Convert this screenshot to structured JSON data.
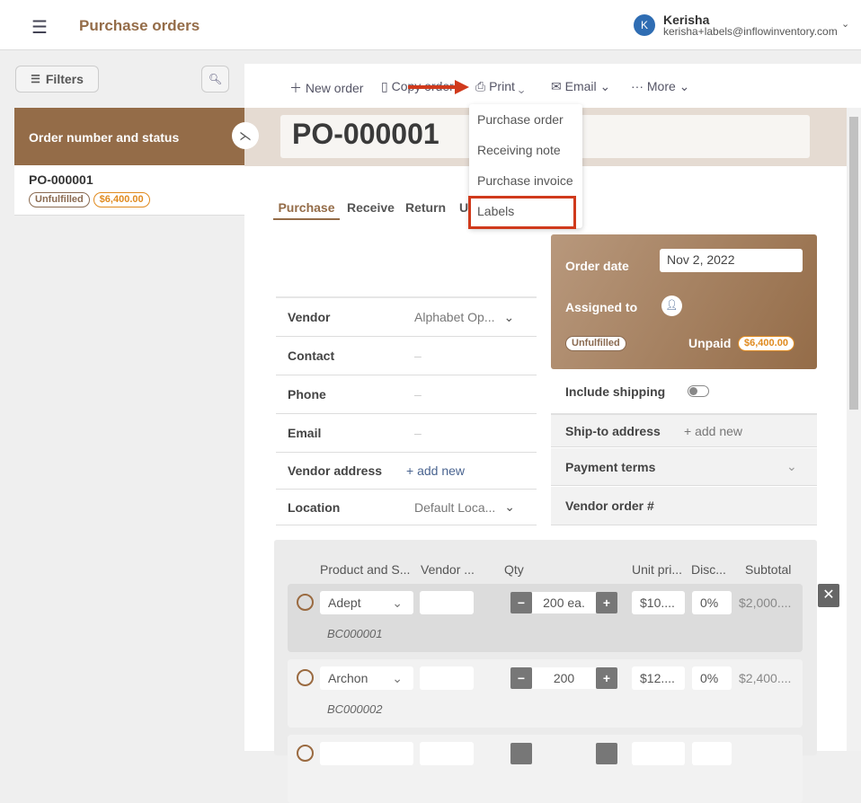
{
  "header": {
    "title": "Purchase orders",
    "user_name": "Kerisha",
    "user_email": "kerisha+labels@inflowinventory.com",
    "avatar_initial": "K"
  },
  "sidebar": {
    "filters_label": "Filters",
    "column_header": "Order number and status",
    "items": [
      {
        "number": "PO-000001",
        "status": "Unfulfilled",
        "amount": "$6,400.00"
      }
    ]
  },
  "toolbar": {
    "new_order": "New order",
    "copy_order": "Copy order",
    "print": "Print",
    "email": "Email",
    "more": "More"
  },
  "print_menu": {
    "items": [
      "Purchase order",
      "Receiving note",
      "Purchase invoice",
      "Labels"
    ],
    "highlighted": "Labels"
  },
  "order": {
    "number": "PO-000001"
  },
  "tabs": [
    {
      "label": "Purchase",
      "active": true
    },
    {
      "label": "Receive"
    },
    {
      "label": "Return"
    },
    {
      "label": "U"
    }
  ],
  "vendor_form": {
    "vendor_label": "Vendor",
    "vendor_value": "Alphabet Op...",
    "contact_label": "Contact",
    "contact_value": "–",
    "phone_label": "Phone",
    "phone_value": "–",
    "email_label": "Email",
    "email_value": "–",
    "address_label": "Vendor address",
    "address_value": "+ add new",
    "location_label": "Location",
    "location_value": "Default Loca..."
  },
  "summary": {
    "order_date_label": "Order date",
    "order_date": "Nov 2, 2022",
    "assigned_label": "Assigned to",
    "status": "Unfulfilled",
    "payment_status": "Unpaid",
    "amount": "$6,400.00"
  },
  "shipping": {
    "include_label": "Include shipping",
    "include_on": false,
    "ship_to_label": "Ship-to address",
    "ship_to_value": "+ add new",
    "payment_terms_label": "Payment terms",
    "vendor_order_label": "Vendor order #"
  },
  "lines": {
    "columns": [
      "Product and S...",
      "Vendor ...",
      "Qty",
      "Unit pri...",
      "Disc...",
      "Subtotal"
    ],
    "rows": [
      {
        "product": "Adept",
        "qty": "200 ea.",
        "unit_price": "$10....",
        "discount": "0%",
        "subtotal": "$2,000....",
        "sku": "BC000001"
      },
      {
        "product": "Archon",
        "qty": "200",
        "unit_price": "$12....",
        "discount": "0%",
        "subtotal": "$2,400....",
        "sku": "BC000002"
      }
    ]
  },
  "colors": {
    "brand": "#946c48",
    "accent_orange": "#e08a1e",
    "annotation_red": "#d03a1c"
  }
}
